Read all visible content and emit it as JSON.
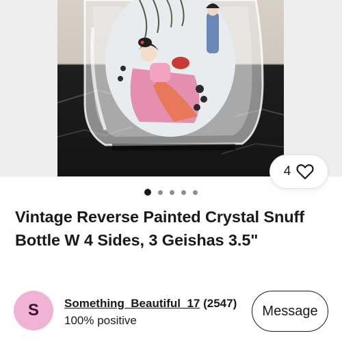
{
  "listing": {
    "watchers_count": "4",
    "carousel": {
      "total": 5,
      "active_index": 0
    },
    "title": "Vintage Reverse Painted Crystal Snuff Bottle W 4 Sides, 3 Geishas 3.5\""
  },
  "seller": {
    "avatar_letter": "S",
    "name": "Something_Beautiful_17",
    "score": "(2547)",
    "feedback": "100% positive",
    "message_label": "Message"
  },
  "icons": {
    "watch": "heart-outline-icon"
  },
  "colors": {
    "avatar_bg": "#f1b3d5",
    "text": "#191919",
    "dot_inactive": "#8f8f8f"
  }
}
